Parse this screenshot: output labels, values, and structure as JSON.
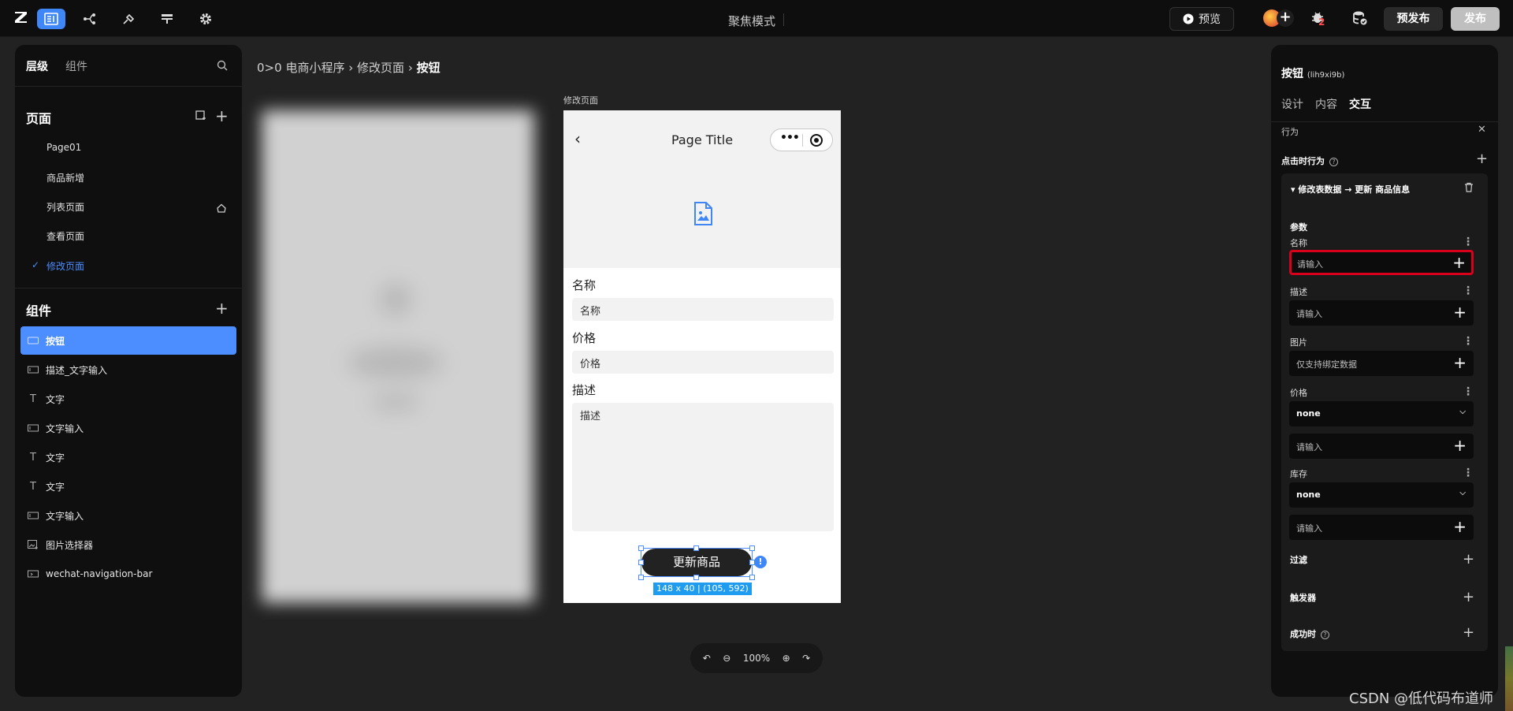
{
  "topbar": {
    "focus_mode": "聚焦模式",
    "preview": "预览",
    "bug_badge": "2",
    "prepublish": "预发布",
    "publish": "发布"
  },
  "left": {
    "tabs": [
      "层级",
      "组件"
    ],
    "pages_title": "页面",
    "pages": [
      "Page01",
      "商品新增",
      "列表页面",
      "查看页面",
      "修改页面"
    ],
    "components_title": "组件",
    "components": [
      "按钮",
      "描述_文字输入",
      "文字",
      "文字输入",
      "文字",
      "文字",
      "文字输入",
      "图片选择器",
      "wechat-navigation-bar"
    ]
  },
  "canvas": {
    "breadcrumb": {
      "root": "0>0",
      "app": "电商小程序",
      "page": "修改页面",
      "current": "按钮",
      "sep": "›"
    },
    "page_label": "修改页面",
    "nav_title": "Page Title",
    "field1_label": "名称",
    "field1_placeholder": "名称",
    "field2_label": "价格",
    "field2_placeholder": "价格",
    "field3_label": "描述",
    "field3_placeholder": "描述",
    "button_label": "更新商品",
    "size_tag": "148 x 40 | (105, 592)",
    "zoom": "100%"
  },
  "right": {
    "title": "按钮",
    "title_id": "(lih9xi9b)",
    "tabs": [
      "设计",
      "内容",
      "交互"
    ],
    "behavior": "行为",
    "click_behavior": "点击时行为",
    "action_head": "修改表数据 → 更新 商品信息",
    "params": "参数",
    "name_label": "名称",
    "name_placeholder": "请输入",
    "desc_label": "描述",
    "desc_placeholder": "请输入",
    "image_label": "图片",
    "image_placeholder": "仅支持绑定数据",
    "price_label": "价格",
    "price_select": "none",
    "price_placeholder": "请输入",
    "stock_label": "库存",
    "stock_select": "none",
    "stock_placeholder": "请输入",
    "filter": "过滤",
    "trigger": "触发器",
    "on_success": "成功时"
  },
  "watermark": "CSDN @低代码布道师",
  "colors": {
    "accent": "#3f86f7",
    "highlight": "#d9001b",
    "size_tag": "#1f9cf0"
  }
}
